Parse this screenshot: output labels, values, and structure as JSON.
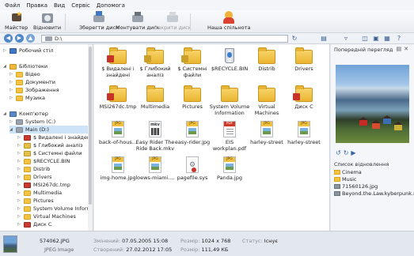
{
  "menu": [
    "Файл",
    "Правка",
    "Вид",
    "Сервіс",
    "Допомога"
  ],
  "toolbar": {
    "wizard": "Майстер",
    "restore": "Відновити",
    "save_disk": "Зберегти диск",
    "mount_disk": "Монтувати диск",
    "close_disk": "Закрити диск",
    "community": "Наша спільнота"
  },
  "address": {
    "path": "D:\\"
  },
  "tree": {
    "desktop": "Робочий стіл",
    "libraries": "Бібліотеки",
    "video": "Відео",
    "documents": "Документи",
    "images": "Зображення",
    "music": "Музика",
    "computer": "Комп'ютер",
    "system_c": "System (C:)",
    "main_d": "Main (D:)",
    "d_items": [
      "$ Видалені і знайдені",
      "$ Глибокий аналіз",
      "$ Системні файли",
      "$RECYCLE.BIN",
      "Distrib",
      "Drivers",
      "MSI267dc.tmp",
      "Multimedia",
      "Pictures",
      "System Volume Informati",
      "Virtual Machines",
      "Диск С"
    ]
  },
  "files": [
    {
      "name": "$ Видалені і знайдені",
      "type": "folder-red"
    },
    {
      "name": "$ Глибокий аналіз",
      "type": "folder-gold"
    },
    {
      "name": "$ Системні файли",
      "type": "folder-gold"
    },
    {
      "name": "$RECYCLE.BIN",
      "type": "bin"
    },
    {
      "name": "Distrib",
      "type": "folder"
    },
    {
      "name": "Drivers",
      "type": "folder"
    },
    {
      "name": "MSI267dc.tmp",
      "type": "folder-red"
    },
    {
      "name": "Multimedia",
      "type": "folder"
    },
    {
      "name": "Pictures",
      "type": "folder"
    },
    {
      "name": "System Volume Information",
      "type": "folder"
    },
    {
      "name": "Virtual Machines",
      "type": "folder"
    },
    {
      "name": "Диск С",
      "type": "folder-red"
    },
    {
      "name": "back-of-hous...",
      "type": "jpg"
    },
    {
      "name": "Easy Rider The Ride Back.mkv",
      "type": "mkv"
    },
    {
      "name": "easy-rider.jpg",
      "type": "jpg"
    },
    {
      "name": "EIS workplan.pdf",
      "type": "pdf"
    },
    {
      "name": "harley-street",
      "type": "jpg"
    },
    {
      "name": "harley-street",
      "type": "jpg"
    },
    {
      "name": "img-home.jpg",
      "type": "jpg"
    },
    {
      "name": "loews-miami....",
      "type": "jpg"
    },
    {
      "name": "pagefile.sys",
      "type": "sys"
    },
    {
      "name": "Panda.jpg",
      "type": "jpg"
    }
  ],
  "preview": {
    "title": "Попередній перегляд",
    "list_title": "Список відновлення",
    "list": [
      {
        "name": "Cinema",
        "kind": "folder"
      },
      {
        "name": "Music",
        "kind": "folder"
      },
      {
        "name": "71560126.jpg",
        "kind": "file"
      },
      {
        "name": "Beyond.the.Law.kyberpunk.mkv",
        "kind": "file"
      }
    ]
  },
  "status": {
    "filename": "574062.JPG",
    "filetype": "JPEG Image",
    "modified_label": "Змінений:",
    "modified": "07.05.2005 15:08",
    "created_label": "Створений:",
    "created": "27.02.2012 17:05",
    "size_label": "Розмір:",
    "dims": "1024 x 768",
    "bytes": "111,49 КБ",
    "state_label": "Статус:",
    "state": "Існує"
  }
}
